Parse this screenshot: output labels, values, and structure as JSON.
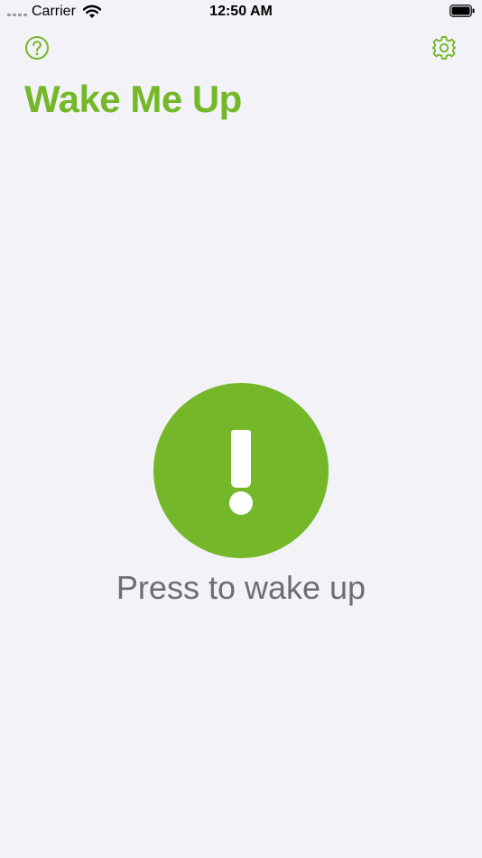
{
  "status_bar": {
    "carrier": "Carrier",
    "time": "12:50 AM"
  },
  "colors": {
    "accent": "#74b829",
    "background": "#f2f2f7",
    "label": "#6d6d72"
  },
  "nav": {
    "help_icon": "question-circle-icon",
    "settings_icon": "gear-icon"
  },
  "title": "Wake Me Up",
  "wake_button": {
    "icon": "exclamation-icon",
    "label": "Press to wake up"
  }
}
